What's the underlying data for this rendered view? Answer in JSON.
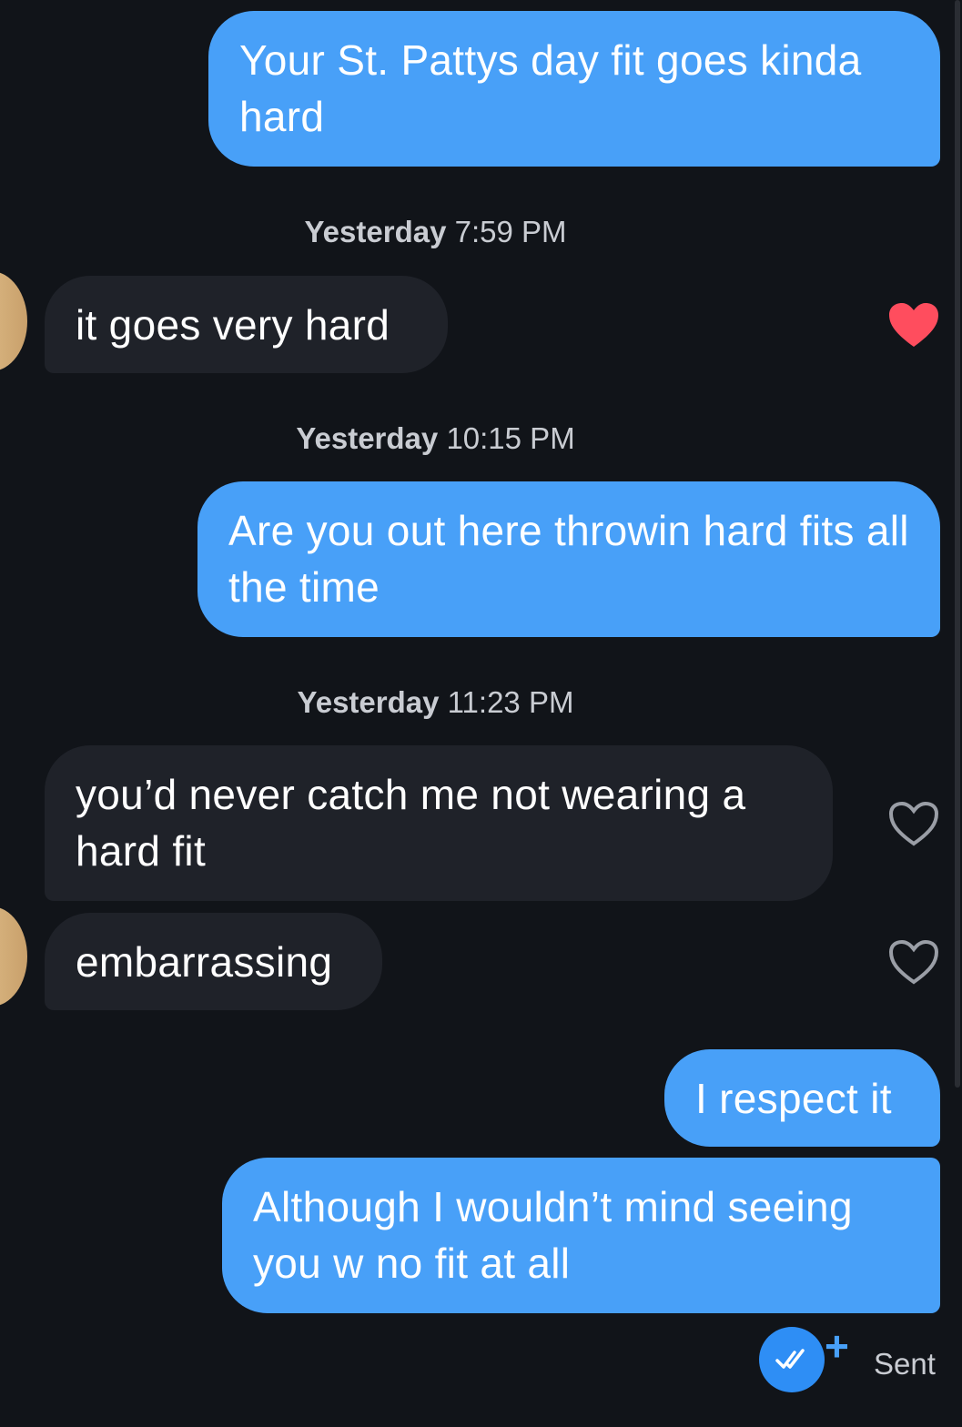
{
  "messages": [
    {
      "id": "m1",
      "direction": "out",
      "text": "Your St. Pattys day fit goes kinda hard"
    },
    {
      "id": "m2",
      "direction": "in",
      "text": "it goes very hard",
      "liked": true
    },
    {
      "id": "m3",
      "direction": "out",
      "text": "Are you out here throwin hard fits all the time"
    },
    {
      "id": "m4",
      "direction": "in",
      "text": "you’d never catch me not wearing a hard fit",
      "liked": false
    },
    {
      "id": "m5",
      "direction": "in",
      "text": "embarrassing",
      "liked": false
    },
    {
      "id": "m6",
      "direction": "out",
      "text": "I respect it"
    },
    {
      "id": "m7",
      "direction": "out",
      "text": "Although I wouldn’t mind seeing you w no fit at all"
    }
  ],
  "timestamps": [
    {
      "day": "Yesterday",
      "time": "7:59 PM"
    },
    {
      "day": "Yesterday",
      "time": "10:15 PM"
    },
    {
      "day": "Yesterday",
      "time": "11:23 PM"
    }
  ],
  "status": {
    "label": "Sent",
    "plus": "+",
    "icon": "double-check-icon"
  },
  "colors": {
    "background": "#111419",
    "outgoing_bubble": "#48a0f8",
    "incoming_bubble": "#1f2229",
    "heart_liked": "#ff4d5e",
    "heart_outline": "#9a9ea6"
  }
}
